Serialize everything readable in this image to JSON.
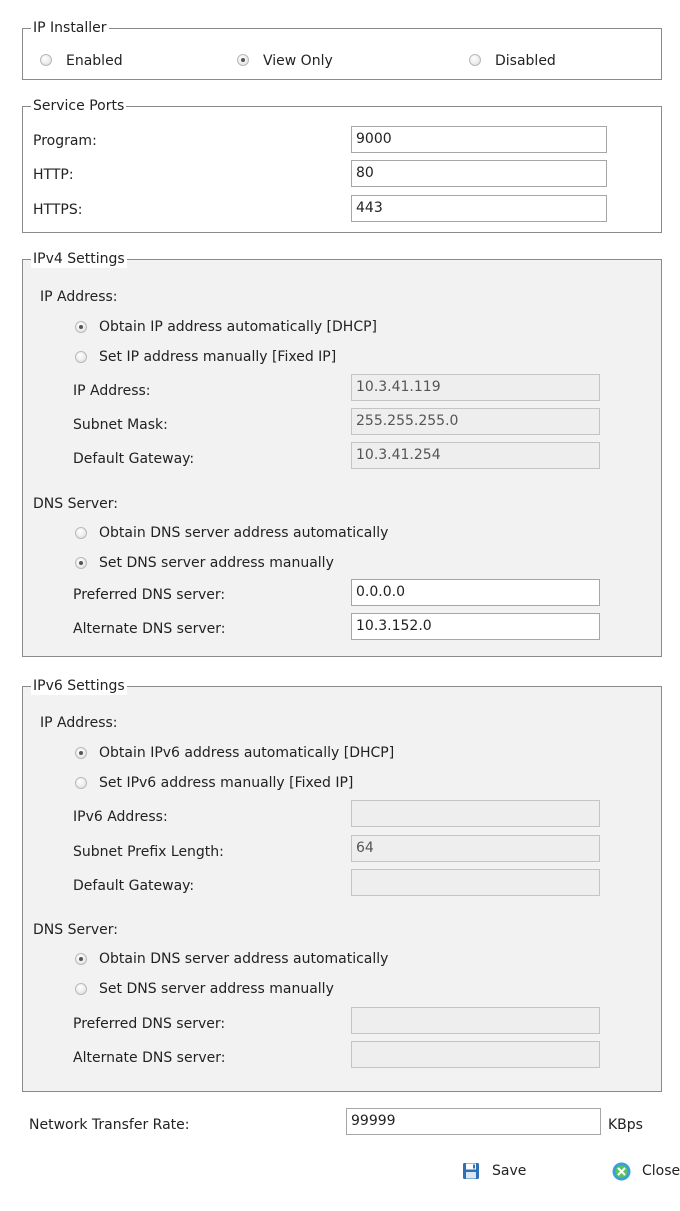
{
  "ip_installer": {
    "legend": "IP Installer",
    "options": [
      {
        "label": "Enabled",
        "checked": false
      },
      {
        "label": "View Only",
        "checked": true
      },
      {
        "label": "Disabled",
        "checked": false
      }
    ]
  },
  "service_ports": {
    "legend": "Service Ports",
    "program_label": "Program:",
    "program_value": "9000",
    "http_label": "HTTP:",
    "http_value": "80",
    "https_label": "HTTPS:",
    "https_value": "443"
  },
  "ipv4": {
    "legend": "IPv4 Settings",
    "ip_heading": "IP Address:",
    "ip_auto_label": "Obtain IP address automatically [DHCP]",
    "ip_manual_label": "Set IP address manually [Fixed IP]",
    "ip_mode": "auto",
    "ip_address_label": "IP Address:",
    "ip_address_value": "10.3.41.119",
    "subnet_label": "Subnet Mask:",
    "subnet_value": "255.255.255.0",
    "gateway_label": "Default Gateway:",
    "gateway_value": "10.3.41.254",
    "dns_heading": "DNS Server:",
    "dns_auto_label": "Obtain DNS server address automatically",
    "dns_manual_label": "Set DNS server address manually",
    "dns_mode": "manual",
    "preferred_dns_label": "Preferred DNS server:",
    "preferred_dns_value": "0.0.0.0",
    "alternate_dns_label": "Alternate DNS server:",
    "alternate_dns_value": "10.3.152.0"
  },
  "ipv6": {
    "legend": "IPv6 Settings",
    "ip_heading": "IP Address:",
    "ip_auto_label": "Obtain IPv6 address automatically [DHCP]",
    "ip_manual_label": "Set IPv6 address manually [Fixed IP]",
    "ip_mode": "auto",
    "ip_address_label": "IPv6 Address:",
    "ip_address_value": "",
    "prefix_label": "Subnet Prefix Length:",
    "prefix_value": "64",
    "gateway_label": "Default Gateway:",
    "gateway_value": "",
    "dns_heading": "DNS Server:",
    "dns_auto_label": "Obtain DNS server address automatically",
    "dns_manual_label": "Set DNS server address manually",
    "dns_mode": "auto",
    "preferred_dns_label": "Preferred DNS server:",
    "preferred_dns_value": "",
    "alternate_dns_label": "Alternate DNS server:",
    "alternate_dns_value": ""
  },
  "transfer_rate": {
    "label": "Network Transfer Rate:",
    "value": "99999",
    "unit": "KBps"
  },
  "footer": {
    "save_label": "Save",
    "close_label": "Close",
    "save_icon": "save-icon",
    "close_icon": "close-icon"
  }
}
